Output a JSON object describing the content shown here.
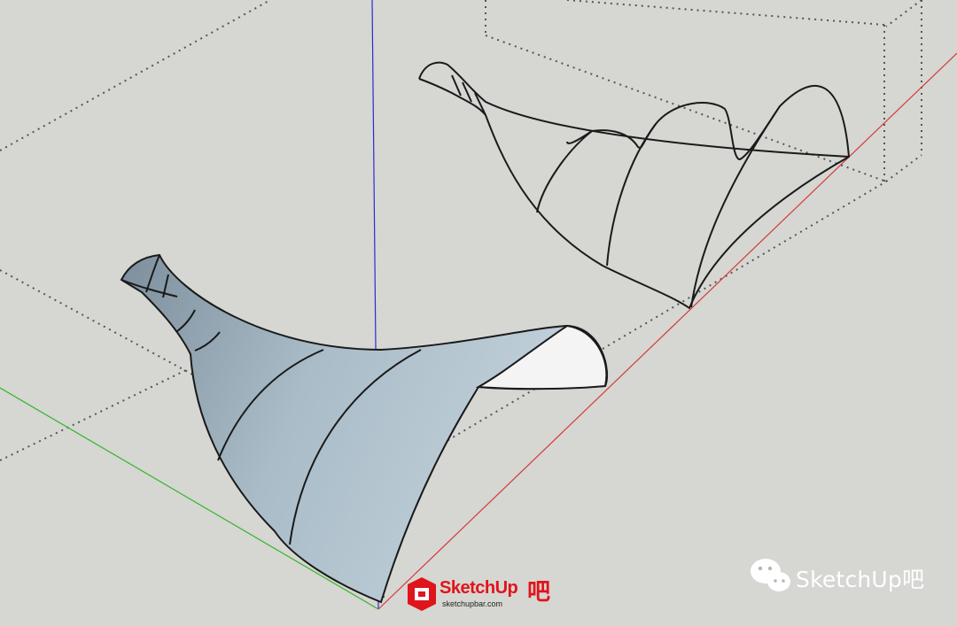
{
  "scene": {
    "background": "#d6d6d2",
    "axes": {
      "red": "#d23a3a",
      "green": "#34b52a",
      "blue": "#2b2bd4"
    },
    "objects": [
      "shaded-surface",
      "wireframe-surface"
    ]
  },
  "watermarks": {
    "wechat_label": "SketchUp吧",
    "logo_text": "SketchUp",
    "logo_suffix": "吧",
    "logo_url": "sketchupbar.com"
  }
}
